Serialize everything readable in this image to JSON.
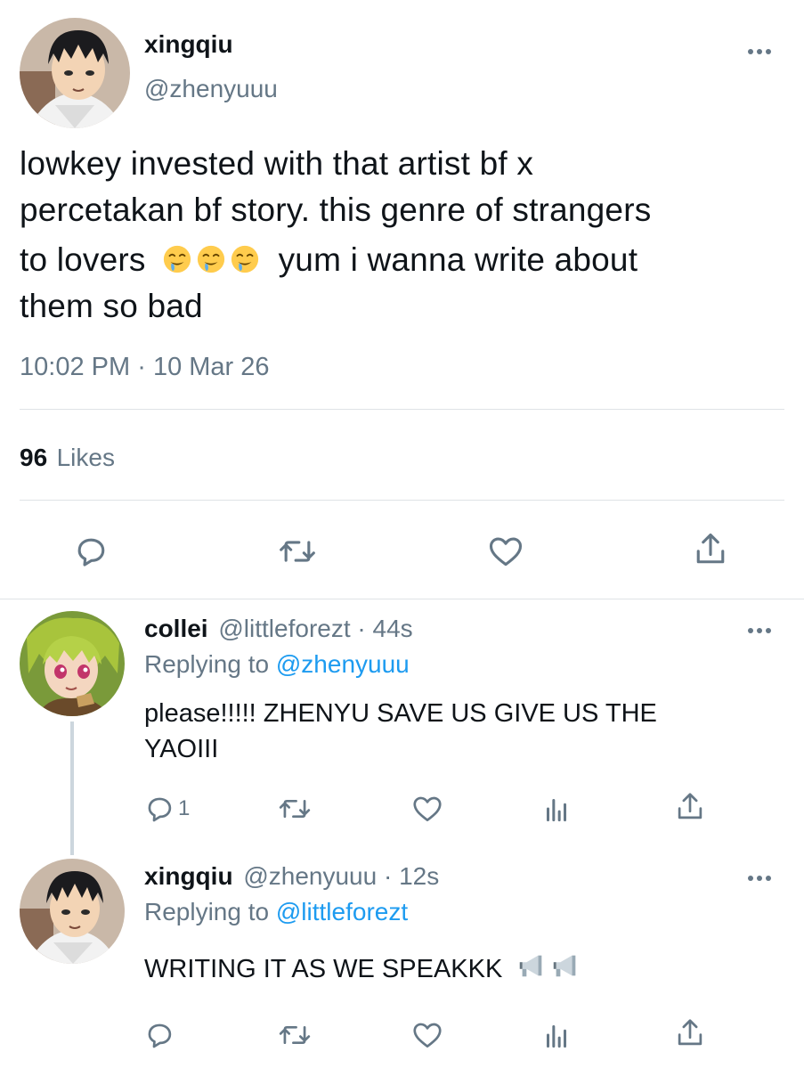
{
  "main_tweet": {
    "author": {
      "name": "xingqiu",
      "handle": "@zhenyuuu"
    },
    "text_parts": [
      "lowkey invested with that artist bf x",
      "percetakan bf story. this genre of strangers",
      "to lovers",
      "yum i wanna write about",
      "them so bad"
    ],
    "emoji_name": "drooling-face",
    "emoji_count": 3,
    "time": "10:02 PM",
    "separator": "·",
    "date": "10 Mar 26",
    "likes_count": "96",
    "likes_label": "Likes",
    "actions": [
      "reply-icon",
      "retweet-icon",
      "like-icon",
      "share-icon"
    ]
  },
  "replies": [
    {
      "name": "collei",
      "handle": "@littleforezt",
      "separator": "·",
      "time": "44s",
      "replying_prefix": "Replying to",
      "replying_to": "@zhenyuuu",
      "text_lines": [
        "please!!!!! ZHENYU SAVE US GIVE US THE",
        "YAOIII"
      ],
      "reply_count": "1",
      "actions": [
        "reply-icon",
        "retweet-icon",
        "like-icon",
        "analytics-icon",
        "share-icon"
      ]
    },
    {
      "name": "xingqiu",
      "handle": "@zhenyuuu",
      "separator": "·",
      "time": "12s",
      "replying_prefix": "Replying to",
      "replying_to": "@littleforezt",
      "text_lines": [
        "WRITING IT AS WE SPEAKKK"
      ],
      "emoji_name": "loudspeaker",
      "emoji_count": 2,
      "reply_count": "",
      "actions": [
        "reply-icon",
        "retweet-icon",
        "like-icon",
        "analytics-icon",
        "share-icon"
      ]
    }
  ],
  "colors": {
    "text": "#0f1419",
    "secondary": "#657786",
    "link": "#1d9bf0",
    "divider": "#dfe3e6"
  }
}
